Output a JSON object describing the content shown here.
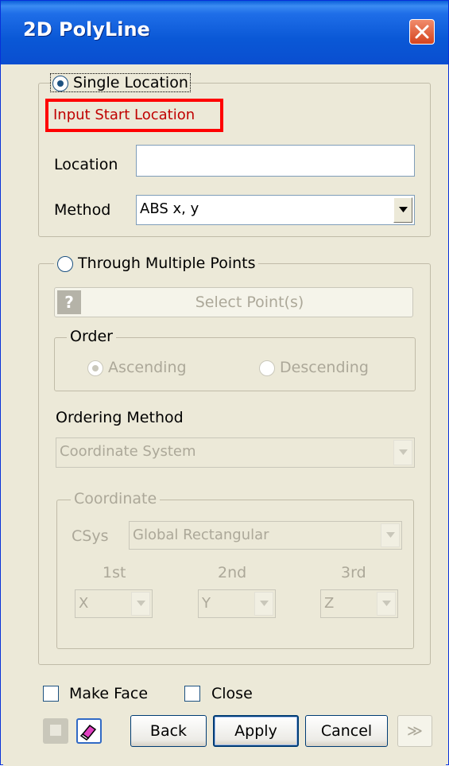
{
  "window": {
    "title": "2D PolyLine"
  },
  "single": {
    "label": "Single Location",
    "hint": "Input Start Location",
    "location_label": "Location",
    "location_value": "",
    "method_label": "Method",
    "method_value": "ABS x, y"
  },
  "multi": {
    "label": "Through Multiple Points",
    "help_glyph": "?",
    "select_points": "Select Point(s)",
    "order_label": "Order",
    "ascending": "Ascending",
    "descending": "Descending",
    "ordering_method_label": "Ordering Method",
    "ordering_method_value": "Coordinate System",
    "coordinate_label": "Coordinate",
    "csys_label": "CSys",
    "csys_value": "Global Rectangular",
    "first_label": "1st",
    "second_label": "2nd",
    "third_label": "3rd",
    "first_value": "X",
    "second_value": "Y",
    "third_value": "Z"
  },
  "options": {
    "make_face": "Make Face",
    "close": "Close"
  },
  "buttons": {
    "back": "Back",
    "apply": "Apply",
    "cancel": "Cancel",
    "more": "≫"
  }
}
